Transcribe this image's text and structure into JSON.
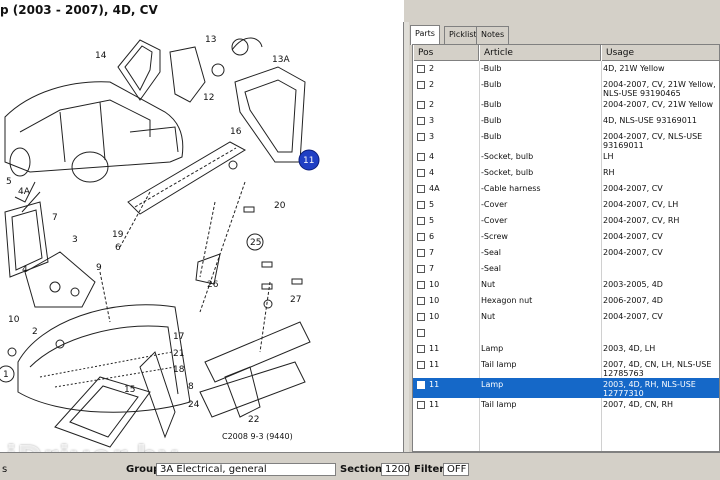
{
  "title": "p    (2003 - 2007), 4D, CV",
  "diagram": {
    "callouts": [
      "13",
      "14",
      "13A",
      "12",
      "16",
      "11",
      "4A",
      "7",
      "5",
      "4",
      "3",
      "20",
      "25",
      "19",
      "6",
      "26",
      "9",
      "27",
      "10",
      "2",
      "17",
      "21",
      "18",
      "1",
      "15",
      "22",
      "24",
      "8"
    ],
    "copyright": "C2008 9-3 (9440)",
    "watermark": "iDriver.by"
  },
  "tabs": [
    "Parts",
    "Picklist",
    "Notes"
  ],
  "grid": {
    "headers": [
      "Pos",
      "Article",
      "Usage"
    ],
    "rows": [
      {
        "pos": "2",
        "article": "-Bulb",
        "usage": [
          "4D, 21W Yellow"
        ],
        "selected": false
      },
      {
        "pos": "2",
        "article": "-Bulb",
        "usage": [
          "2004-2007, CV, 21W Yellow,",
          "NLS-USE 93190465"
        ],
        "selected": false
      },
      {
        "pos": "2",
        "article": "-Bulb",
        "usage": [
          "2004-2007, CV, 21W Yellow"
        ],
        "selected": false
      },
      {
        "pos": "3",
        "article": "-Bulb",
        "usage": [
          "4D, NLS-USE 93169011"
        ],
        "selected": false
      },
      {
        "pos": "3",
        "article": "-Bulb",
        "usage": [
          "2004-2007, CV, NLS-USE",
          "93169011"
        ],
        "selected": false
      },
      {
        "pos": "4",
        "article": "-Socket, bulb",
        "usage": [
          "LH"
        ],
        "selected": false
      },
      {
        "pos": "4",
        "article": "-Socket, bulb",
        "usage": [
          "RH"
        ],
        "selected": false
      },
      {
        "pos": "4A",
        "article": "-Cable harness",
        "usage": [
          "2004-2007, CV"
        ],
        "selected": false
      },
      {
        "pos": "5",
        "article": "-Cover",
        "usage": [
          "2004-2007, CV, LH"
        ],
        "selected": false
      },
      {
        "pos": "5",
        "article": "-Cover",
        "usage": [
          "2004-2007, CV, RH"
        ],
        "selected": false
      },
      {
        "pos": "6",
        "article": "-Screw",
        "usage": [
          "2004-2007, CV"
        ],
        "selected": false
      },
      {
        "pos": "7",
        "article": "-Seal",
        "usage": [
          "2004-2007, CV"
        ],
        "selected": false
      },
      {
        "pos": "7",
        "article": "-Seal",
        "usage": [
          ""
        ],
        "selected": false
      },
      {
        "pos": "10",
        "article": "Nut",
        "usage": [
          "2003-2005, 4D"
        ],
        "selected": false
      },
      {
        "pos": "10",
        "article": "Hexagon nut",
        "usage": [
          "2006-2007, 4D"
        ],
        "selected": false
      },
      {
        "pos": "10",
        "article": "Nut",
        "usage": [
          "2004-2007, CV"
        ],
        "selected": false
      },
      {
        "pos": "",
        "article": "",
        "usage": [
          ""
        ],
        "selected": false
      },
      {
        "pos": "11",
        "article": "Lamp",
        "usage": [
          "2003, 4D, LH"
        ],
        "selected": false
      },
      {
        "pos": "11",
        "article": "Tail lamp",
        "usage": [
          "2007, 4D, CN, LH, NLS-USE",
          "12785763"
        ],
        "selected": false
      },
      {
        "pos": "11",
        "article": "Lamp",
        "usage": [
          "2003, 4D, RH, NLS-USE",
          "12777310"
        ],
        "selected": true
      },
      {
        "pos": "11",
        "article": "Tail lamp",
        "usage": [
          "2007, 4D, CN, RH"
        ],
        "selected": false
      }
    ]
  },
  "status": {
    "left_text": "s",
    "group_label": "Group",
    "group_value": "3A Electrical, general",
    "section_label": "Section",
    "section_value": "1200",
    "filter_label": "Filter",
    "filter_value": "OFF"
  },
  "colors": {
    "selection": "#1568c8",
    "callout_highlight": "#1f3fc4"
  }
}
